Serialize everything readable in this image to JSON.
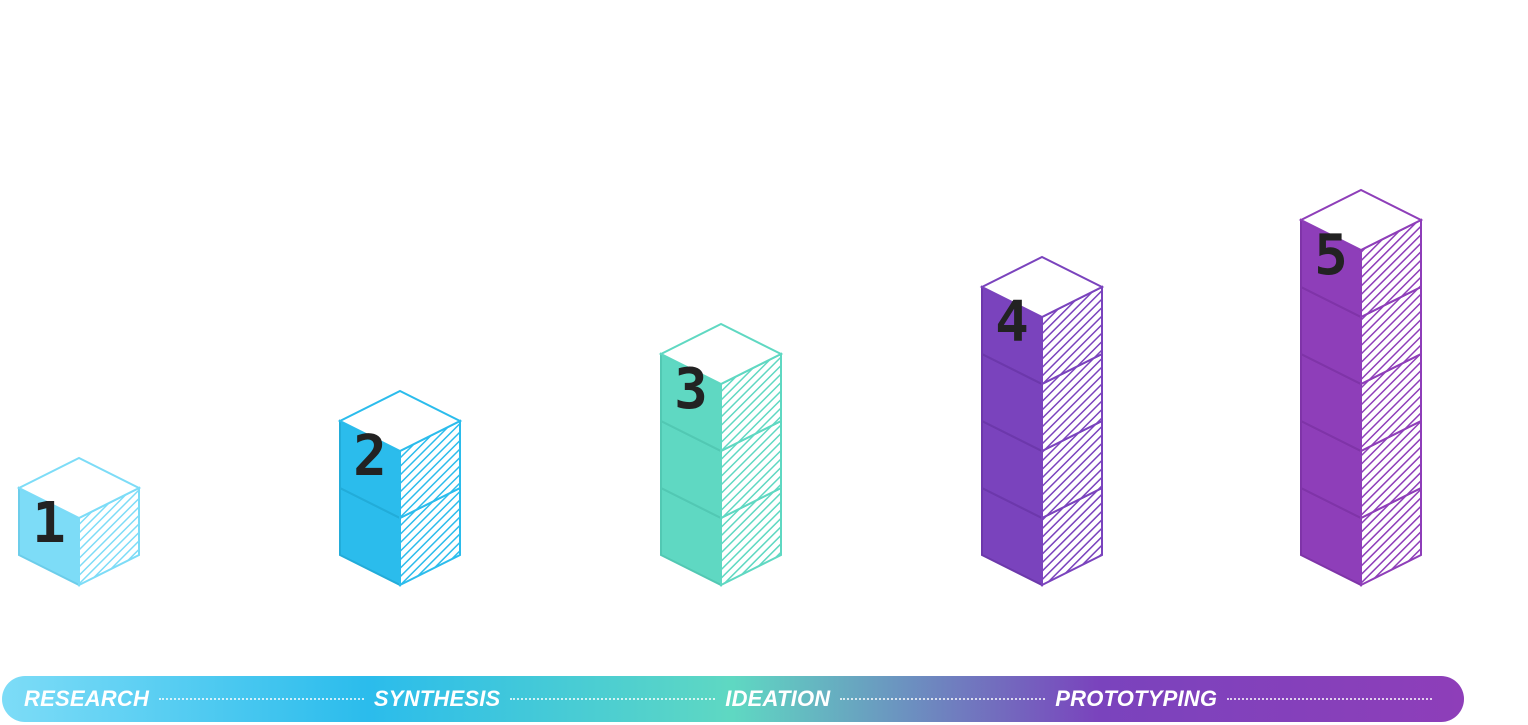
{
  "steps": [
    {
      "label": "1",
      "stack_height": 1,
      "color": "#7ddcf7",
      "shade": "#6ccdea"
    },
    {
      "label": "2",
      "stack_height": 2,
      "color": "#2bbcec",
      "shade": "#22acd9"
    },
    {
      "label": "3",
      "stack_height": 3,
      "color": "#5fd8c2",
      "shade": "#52c8b3"
    },
    {
      "label": "4",
      "stack_height": 4,
      "color": "#7a43bd",
      "shade": "#6c38ab"
    },
    {
      "label": "5",
      "stack_height": 5,
      "color": "#8e3eb9",
      "shade": "#7f34a8"
    }
  ],
  "phases": {
    "research": "RESEARCH",
    "synthesis": "SYNTHESIS",
    "ideation": "IDEATION",
    "prototyping": "PROTOTYPING"
  },
  "bar_gradient": [
    "#7ddcf7",
    "#2bbcec",
    "#5fd8c2",
    "#7a43bd",
    "#8e3eb9"
  ]
}
